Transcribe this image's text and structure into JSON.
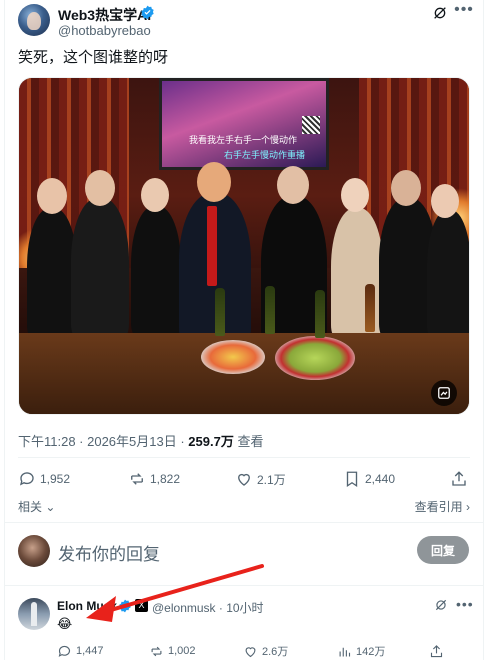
{
  "tweet": {
    "author_name": "Web3热宝学AI",
    "author_handle": "@hotbabyrebao",
    "text": "笑死，这个图谁整的呀",
    "media_overlay_line1": "我看我左手右手一个慢动作",
    "media_overlay_line2": "右手左手慢动作重播",
    "time": "下午11:28 · 2026年5月13日 · ",
    "views": "259.7万",
    "views_label": " 查看"
  },
  "stats": {
    "replies": "1,952",
    "reposts": "1,822",
    "likes": "2.1万",
    "bookmarks": "2,440"
  },
  "links": {
    "related": "相关",
    "view_quotes": "查看引用"
  },
  "composer": {
    "placeholder": "发布你的回复",
    "reply_button": "回复"
  },
  "reply": {
    "author_name": "Elon Musk",
    "author_handle": "@elonmusk · 10小时",
    "text": "😂",
    "x_badge": "X",
    "replies": "1,447",
    "reposts": "1,002",
    "likes": "2.6万",
    "views": "142万"
  },
  "colors": {
    "verified": "#1d9bf0",
    "secondary_text": "#536471",
    "annotation_arrow": "#e8221b"
  }
}
